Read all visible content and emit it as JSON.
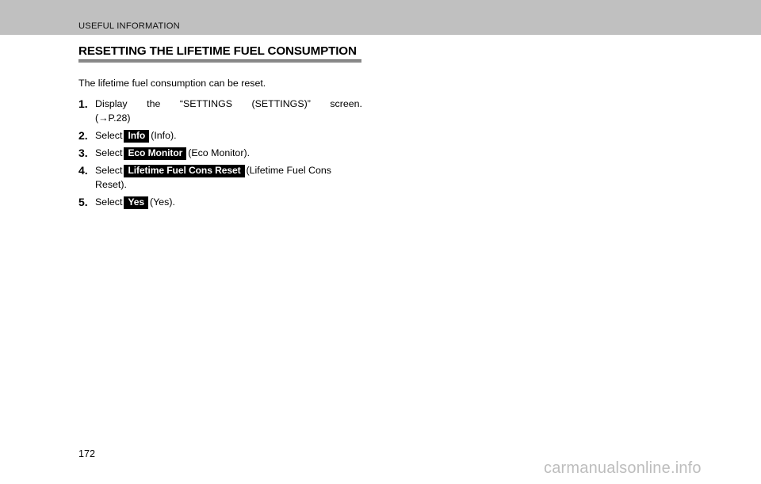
{
  "header": {
    "running_title": "USEFUL INFORMATION"
  },
  "section": {
    "heading": "RESETTING THE LIFETIME FUEL CONSUMPTION"
  },
  "body": {
    "intro": "The lifetime fuel consumption can be reset.",
    "steps": [
      {
        "number": "1.",
        "line1": "Display the “SETTINGS (SETTINGS)” screen.",
        "line2": "(→P.28)"
      },
      {
        "number": "2.",
        "prefix": "Select",
        "chip": "Info",
        "suffix": "(Info)."
      },
      {
        "number": "3.",
        "prefix": "Select",
        "chip": "Eco Monitor",
        "suffix": "(Eco Monitor)."
      },
      {
        "number": "4.",
        "prefix": "Select",
        "chip": "Lifetime Fuel Cons Reset",
        "suffix": "(Lifetime Fuel Cons Reset)."
      },
      {
        "number": "5.",
        "prefix": "Select",
        "chip": "Yes",
        "suffix": "(Yes)."
      }
    ]
  },
  "footer": {
    "page_number": "172",
    "watermark": "carmanualsonline.info"
  },
  "colors": {
    "header_bar": "#c0c0c0",
    "rule": "#8a8a8a",
    "chip_background": "#000000",
    "chip_text": "#ffffff",
    "watermark": "#bdbdbd",
    "page_background": "#ffffff"
  }
}
